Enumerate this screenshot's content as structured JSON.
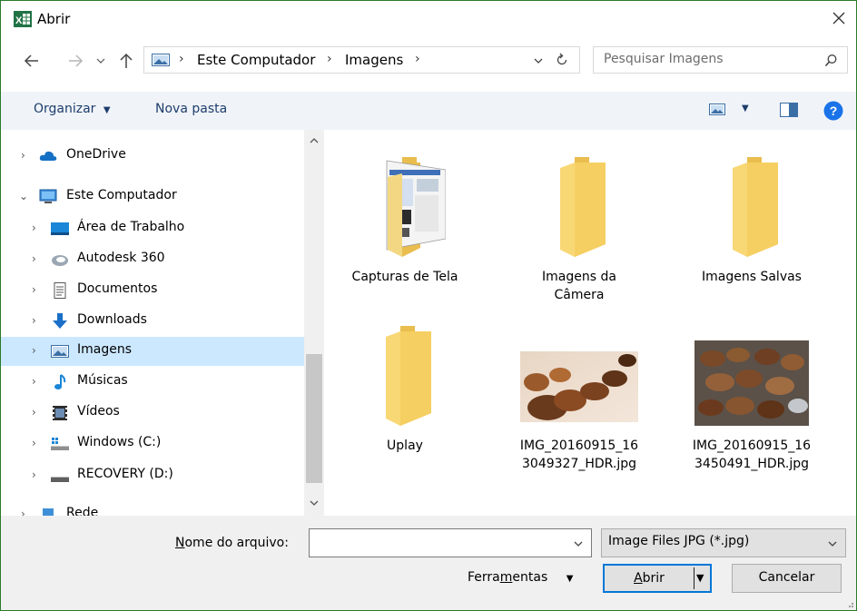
{
  "window": {
    "title": "Abrir",
    "brand_color": "#217346"
  },
  "nav": {
    "breadcrumbs": [
      "Este Computador",
      "Imagens"
    ],
    "search_placeholder": "Pesquisar Imagens"
  },
  "toolbar": {
    "organize_label": "Organizar",
    "new_folder_label": "Nova pasta"
  },
  "tree": [
    {
      "label": "OneDrive",
      "icon": "cloud-icon",
      "expanded": false
    },
    {
      "label": "Este Computador",
      "icon": "computer-icon",
      "expanded": true
    },
    {
      "label": "Área de Trabalho",
      "icon": "desktop-icon"
    },
    {
      "label": "Autodesk 360",
      "icon": "autodesk-icon"
    },
    {
      "label": "Documentos",
      "icon": "documents-icon"
    },
    {
      "label": "Downloads",
      "icon": "download-icon"
    },
    {
      "label": "Imagens",
      "icon": "pictures-icon",
      "selected": true
    },
    {
      "label": "Músicas",
      "icon": "music-icon"
    },
    {
      "label": "Vídeos",
      "icon": "video-icon"
    },
    {
      "label": "Windows (C:)",
      "icon": "drive-icon"
    },
    {
      "label": "RECOVERY (D:)",
      "icon": "drive-icon"
    },
    {
      "label": "Rede",
      "icon": "network-icon"
    }
  ],
  "items": [
    {
      "name": "Capturas de Tela",
      "kind": "folder-with-preview"
    },
    {
      "name": "Imagens da Câmera",
      "kind": "folder"
    },
    {
      "name": "Imagens Salvas",
      "kind": "folder"
    },
    {
      "name": "Uplay",
      "kind": "folder"
    },
    {
      "name": "IMG_20160915_163049327_HDR.jpg",
      "kind": "image",
      "name_line1": "IMG_20160915_16",
      "name_line2": "3049327_HDR.jpg"
    },
    {
      "name": "IMG_20160915_163450491_HDR.jpg",
      "kind": "image",
      "name_line1": "IMG_20160915_16",
      "name_line2": "3450491_HDR.jpg"
    }
  ],
  "footer": {
    "filename_label": "Nome do arquivo:",
    "filename_value": "",
    "filter_value": "Image Files JPG (*.jpg)",
    "tools_label": "Ferramentas",
    "open_label": "Abrir",
    "cancel_label": "Cancelar"
  },
  "colors": {
    "selection": "#cce8ff",
    "toolbar_bg": "#f0f4f9",
    "folder": "#f8d775",
    "help": "#1a73e8"
  }
}
